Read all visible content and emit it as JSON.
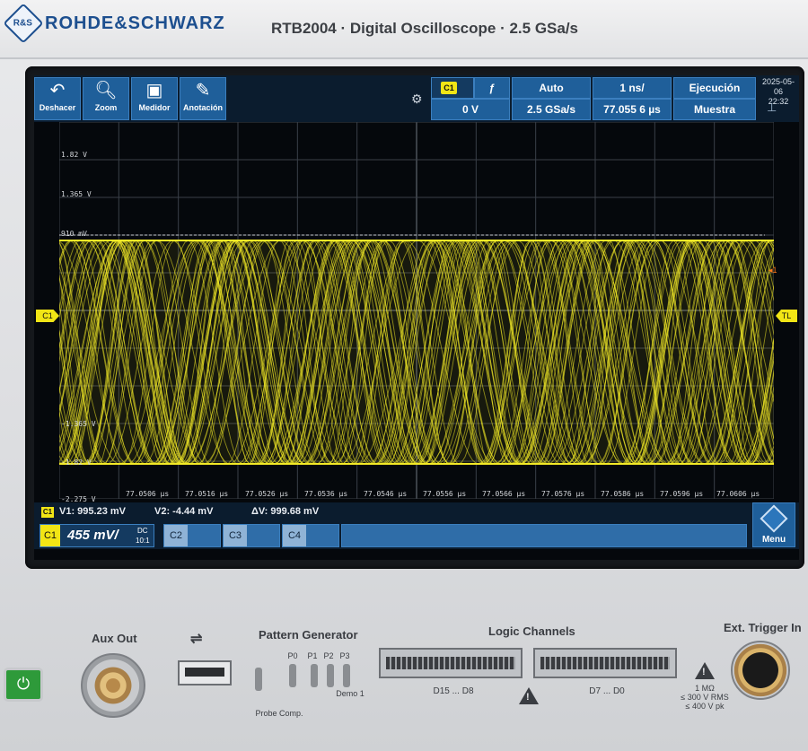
{
  "brand": {
    "logo": "R&S",
    "name": "ROHDE&SCHWARZ"
  },
  "model_line": "RTB2004 · Digital Oscilloscope · 2.5 GSa/s",
  "toolbar": {
    "buttons": [
      {
        "label": "Deshacer",
        "icon": "undo-icon"
      },
      {
        "label": "Zoom",
        "icon": "zoom-icon"
      },
      {
        "label": "Medidor",
        "icon": "meter-icon"
      },
      {
        "label": "Anotación",
        "icon": "pen-icon"
      }
    ],
    "trigger_channel": "C1",
    "trigger_level": "0 V",
    "trigger_mode": "Auto",
    "sample_rate": "2.5 GSa/s",
    "timebase": "1 ns/",
    "time_position": "77.055 6 µs",
    "run_state": "Ejecución",
    "acq_mode": "Muestra",
    "date": "2025-05-06",
    "time": "22:32"
  },
  "plot": {
    "y_labels": [
      "1.82 V",
      "1.365 V",
      "910 mV",
      "-1.365 V",
      "-1.82 V",
      "-2.275 V"
    ],
    "x_labels": [
      "77.0506 µs",
      "77.0516 µs",
      "77.0526 µs",
      "77.0536 µs",
      "77.0546 µs",
      "77.0556 µs",
      "77.0566 µs",
      "77.0576 µs",
      "77.0586 µs",
      "77.0596 µs",
      "77.0606 µs"
    ],
    "left_marker": "C1",
    "right_marker": "TL",
    "cursor_marker": "1",
    "trace_color": "#f3ea27"
  },
  "measurements": {
    "tag": "C1",
    "v1": "V1: 995.23 mV",
    "v2": "V2: -4.44 mV",
    "dv": "ΔV: 999.68 mV"
  },
  "channels": {
    "c1": {
      "tag": "C1",
      "scale": "455 mV/",
      "coupling": "DC",
      "probe": "10:1"
    },
    "c2": "C2",
    "c3": "C3",
    "c4": "C4",
    "menu": "Menu"
  },
  "front_panel": {
    "aux_out": "Aux Out",
    "usb_icon": "usb-icon",
    "pattern_generator": "Pattern Generator",
    "pattern_pins": [
      "P0",
      "P1",
      "P2",
      "P3"
    ],
    "probe_comp": "Probe Comp.",
    "demo": "Demo 1",
    "logic_channels": "Logic Channels",
    "logic_left": "D15 ... D8",
    "logic_right": "D7 ... D0",
    "ext_trigger": "Ext. Trigger In",
    "ext_specs": [
      "1 MΩ",
      "≤ 300 V RMS",
      "≤ 400 V pk"
    ]
  }
}
